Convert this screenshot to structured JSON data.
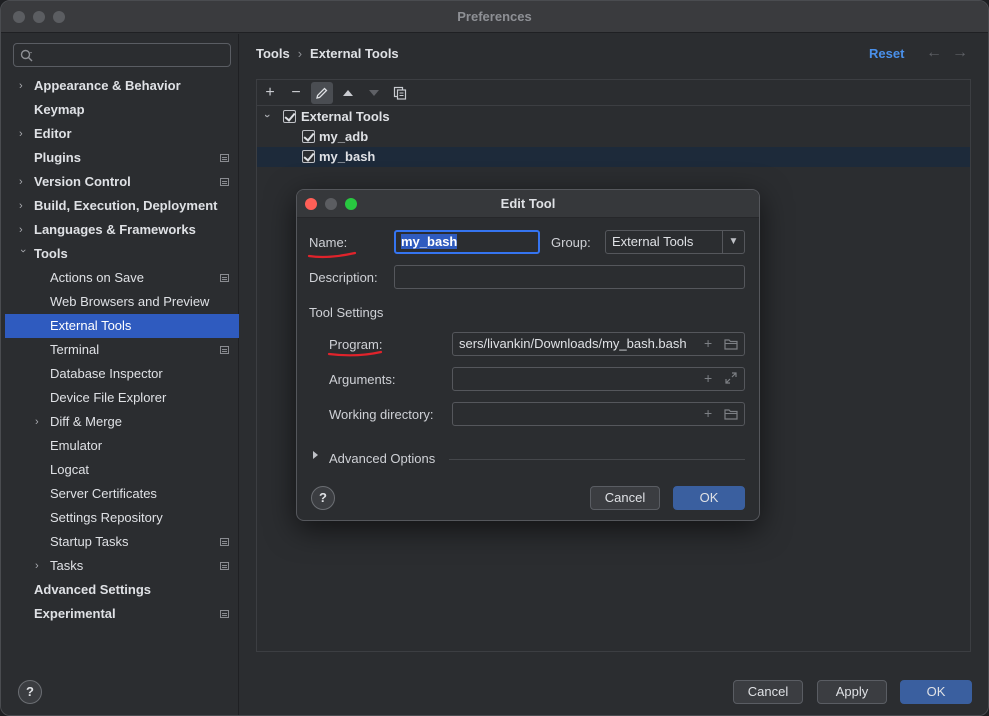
{
  "window": {
    "title": "Preferences"
  },
  "search": {
    "placeholder": ""
  },
  "sidebar": {
    "items": [
      {
        "label": "Appearance & Behavior"
      },
      {
        "label": "Keymap"
      },
      {
        "label": "Editor"
      },
      {
        "label": "Plugins"
      },
      {
        "label": "Version Control"
      },
      {
        "label": "Build, Execution, Deployment"
      },
      {
        "label": "Languages & Frameworks"
      },
      {
        "label": "Tools"
      },
      {
        "label": "Actions on Save"
      },
      {
        "label": "Web Browsers and Preview"
      },
      {
        "label": "External Tools"
      },
      {
        "label": "Terminal"
      },
      {
        "label": "Database Inspector"
      },
      {
        "label": "Device File Explorer"
      },
      {
        "label": "Diff & Merge"
      },
      {
        "label": "Emulator"
      },
      {
        "label": "Logcat"
      },
      {
        "label": "Server Certificates"
      },
      {
        "label": "Settings Repository"
      },
      {
        "label": "Startup Tasks"
      },
      {
        "label": "Tasks"
      },
      {
        "label": "Advanced Settings"
      },
      {
        "label": "Experimental"
      }
    ]
  },
  "breadcrumb": {
    "parent": "Tools",
    "separator": "›",
    "current": "External Tools"
  },
  "header": {
    "reset": "Reset",
    "back": "←",
    "forward": "→"
  },
  "tree": {
    "group": "External Tools",
    "items": [
      "my_adb",
      "my_bash"
    ]
  },
  "dialog": {
    "title": "Edit Tool",
    "name_label": "Name:",
    "name_value": "my_bash",
    "group_label": "Group:",
    "group_value": "External Tools",
    "description_label": "Description:",
    "description_value": "",
    "section_title": "Tool Settings",
    "program_label": "Program:",
    "program_value": "sers/livankin/Downloads/my_bash.bash",
    "arguments_label": "Arguments:",
    "arguments_value": "",
    "working_dir_label": "Working directory:",
    "working_dir_value": "",
    "advanced_label": "Advanced Options",
    "help": "?",
    "cancel": "Cancel",
    "ok": "OK"
  },
  "footer": {
    "help": "?",
    "cancel": "Cancel",
    "apply": "Apply",
    "ok": "OK"
  },
  "colors": {
    "accent": "#2f5bbf",
    "link": "#4a90ea",
    "annotation": "#e0232b",
    "close": "#ff5f57",
    "minimize": "#5b5d61",
    "zoom": "#28c840"
  }
}
